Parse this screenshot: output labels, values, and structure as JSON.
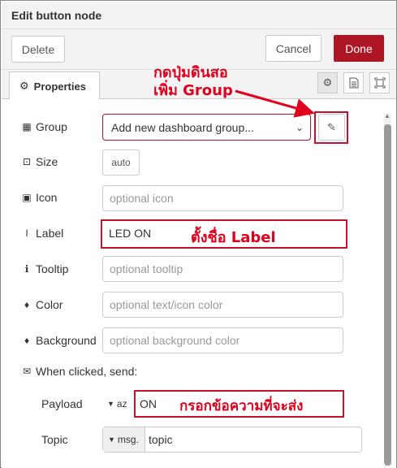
{
  "header": {
    "title": "Edit button node"
  },
  "toolbar": {
    "delete_label": "Delete",
    "cancel_label": "Cancel",
    "done_label": "Done"
  },
  "tabs": {
    "properties_label": "Properties",
    "icons": [
      "gear-icon",
      "description-icon",
      "appearance-icon"
    ]
  },
  "form": {
    "group": {
      "label": "Group",
      "value": "Add new dashboard group..."
    },
    "size": {
      "label": "Size",
      "value": "auto"
    },
    "icon": {
      "label": "Icon",
      "placeholder": "optional icon"
    },
    "label": {
      "label": "Label",
      "value": "LED ON"
    },
    "tooltip": {
      "label": "Tooltip",
      "placeholder": "optional tooltip"
    },
    "color": {
      "label": "Color",
      "placeholder": "optional text/icon color"
    },
    "background": {
      "label": "Background",
      "placeholder": "optional background color"
    },
    "when_clicked": {
      "label": "When clicked, send:"
    },
    "payload": {
      "label": "Payload",
      "type": "az",
      "value": "ON"
    },
    "topic": {
      "label": "Topic",
      "type": "msg.",
      "value": "topic"
    }
  },
  "annotations": {
    "edit_group_line1": "กดปุ่มดินสอ",
    "edit_group_line2": "เพิ่ม Group",
    "label_note": "ตั้งชื่อ Label",
    "payload_note": "กรอกข้อความที่จะส่ง"
  },
  "colors": {
    "accent": "#ad1625",
    "annotation": "#e0001b"
  }
}
